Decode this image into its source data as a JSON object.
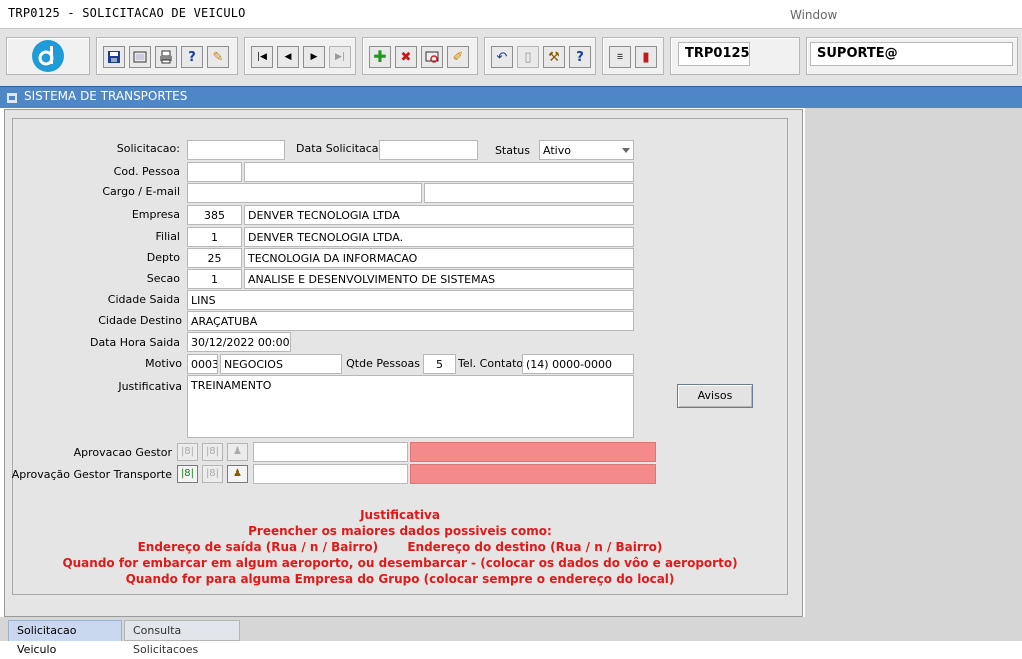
{
  "window": {
    "title": "TRP0125 - SOLICITACAO DE VEICULO",
    "menu": "Window"
  },
  "toolbar": {
    "form_code": "TRP0125",
    "user": "SUPORTE@",
    "icons": [
      "app-logo",
      "save",
      "print-preview",
      "print",
      "help-query",
      "edit-query",
      "first-record",
      "previous-record",
      "next-record",
      "last-record",
      "insert-record",
      "delete-record",
      "query",
      "clear",
      "undo",
      "copy",
      "tools",
      "help",
      "menu",
      "exit"
    ]
  },
  "system": {
    "title": "SISTEMA DE TRANSPORTES"
  },
  "form": {
    "solicitacao": {
      "label": "Solicitacao:",
      "value": ""
    },
    "data_solicitacao": {
      "label": "Data Solicitacao",
      "value": ""
    },
    "status": {
      "label": "Status",
      "value": "Ativo"
    },
    "cod_pessoa": {
      "label": "Cod. Pessoa",
      "code": "",
      "name": ""
    },
    "cargo_email": {
      "label": "Cargo / E-mail",
      "cargo": "",
      "email": ""
    },
    "empresa": {
      "label": "Empresa",
      "code": "385",
      "name": "DENVER TECNOLOGIA LTDA"
    },
    "filial": {
      "label": "Filial",
      "code": "1",
      "name": "DENVER TECNOLOGIA LTDA."
    },
    "depto": {
      "label": "Depto",
      "code": "25",
      "name": "TECNOLOGIA DA INFORMACAO"
    },
    "secao": {
      "label": "Secao",
      "code": "1",
      "name": "ANALISE E DESENVOLVIMENTO DE SISTEMAS"
    },
    "cidade_saida": {
      "label": "Cidade Saida",
      "value": "LINS"
    },
    "cidade_destino": {
      "label": "Cidade Destino",
      "value": "ARAÇATUBA"
    },
    "data_hora_saida": {
      "label": "Data Hora Saida",
      "value": "30/12/2022 00:00"
    },
    "motivo": {
      "label": "Motivo",
      "code": "0003",
      "name": "NEGOCIOS"
    },
    "qtde_pessoas": {
      "label": "Qtde Pessoas",
      "value": "5"
    },
    "tel_contato": {
      "label": "Tel. Contato",
      "value": "(14) 0000-0000"
    },
    "justificativa": {
      "label": "Justificativa",
      "value": "TREINAMENTO"
    },
    "avisos_button": "Avisos",
    "aprovacao_gestor": {
      "label": "Aprovacao Gestor",
      "name": "",
      "status": ""
    },
    "aprovacao_transporte": {
      "label": "Aprovação Gestor Transporte",
      "name": "",
      "status": ""
    }
  },
  "notes": {
    "title": "Justificativa",
    "line1": "Preencher os maiores dados possiveis como:",
    "line2": "Endereço de saída (Rua / n / Bairro)       Endereço do destino (Rua / n / Bairro)",
    "line3": "Quando for embarcar em algum aeroporto, ou desembarcar - (colocar os dados do vôo e aeroporto)",
    "line4": "Quando for para alguma Empresa do Grupo (colocar sempre o endereço do local)"
  },
  "tabs": {
    "solicitacao": "Solicitacao Veiculo",
    "consulta": "Consulta Solicitacoes"
  },
  "colors": {
    "system_bar": "#4f86c6",
    "pink_status": "#f48a8a",
    "note_red": "#e01919"
  }
}
